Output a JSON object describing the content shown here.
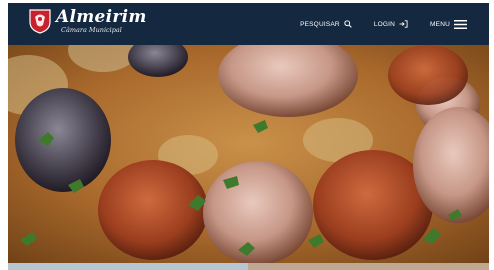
{
  "header": {
    "brand": {
      "name": "Almeirim",
      "subtitle": "Câmara Municipal",
      "crest_icon": "coat-of-arms-icon"
    },
    "nav": {
      "search_label": "PESQUISAR",
      "search_icon": "search-icon",
      "login_label": "LOGIN",
      "login_icon": "login-arrow-icon",
      "menu_label": "MENU",
      "menu_icon": "hamburger-icon"
    }
  },
  "hero": {
    "image_subject": "stone soup with sausage slices and parsley"
  },
  "colors": {
    "header_bg": "#14283f",
    "brand_red": "#c8202c",
    "text_white": "#ffffff"
  }
}
